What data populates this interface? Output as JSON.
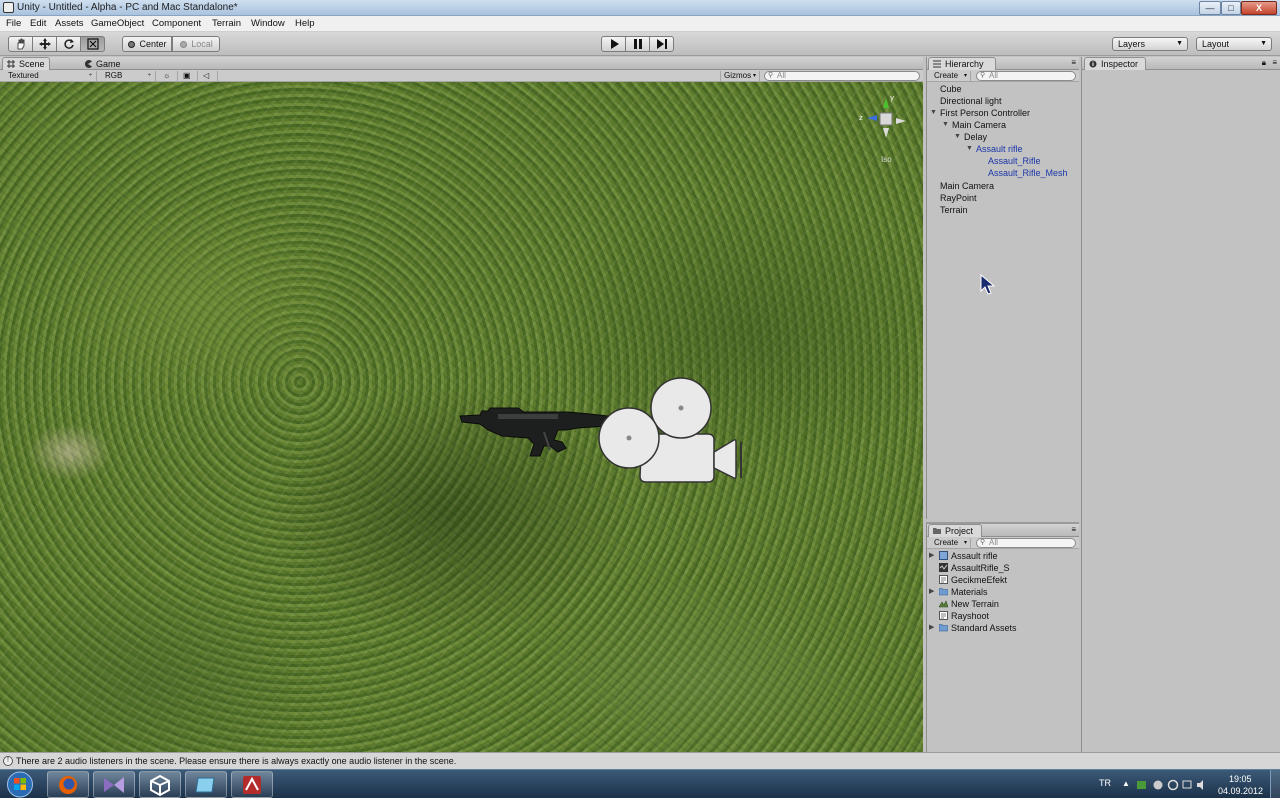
{
  "window": {
    "title": "Unity - Untitled - Alpha - PC and Mac Standalone*",
    "minimize_label": "—",
    "maximize_label": "□",
    "close_label": "X"
  },
  "menu": [
    "File",
    "Edit",
    "Assets",
    "GameObject",
    "Component",
    "Terrain",
    "Window",
    "Help"
  ],
  "toolbar": {
    "pivot_label": "Center",
    "space_label": "Local",
    "layers_label": "Layers",
    "layout_label": "Layout"
  },
  "scene_panel": {
    "tab_scene": "Scene",
    "tab_game": "Game",
    "render_mode": "Textured",
    "color_mode": "RGB",
    "gizmos_label": "Gizmos",
    "search_placeholder": "All",
    "orientation_label": "Iso",
    "axis_y": "y",
    "axis_z": "z"
  },
  "hierarchy": {
    "tab": "Hierarchy",
    "create_label": "Create",
    "search_placeholder": "All",
    "items": [
      {
        "label": "Cube"
      },
      {
        "label": "Directional light"
      },
      {
        "label": "First Person Controller"
      },
      {
        "label": "Main Camera"
      },
      {
        "label": "Delay"
      },
      {
        "label": "Assault rifle"
      },
      {
        "label": "Assault_Rifle"
      },
      {
        "label": "Assault_Rifle_Mesh"
      },
      {
        "label": "Main Camera"
      },
      {
        "label": "RayPoint"
      },
      {
        "label": "Terrain"
      }
    ]
  },
  "project": {
    "tab": "Project",
    "create_label": "Create",
    "search_placeholder": "All",
    "items": [
      {
        "label": "Assault rifle"
      },
      {
        "label": "AssaultRifle_S"
      },
      {
        "label": "GecikmeEfekt"
      },
      {
        "label": "Materials"
      },
      {
        "label": "New Terrain"
      },
      {
        "label": "Rayshoot"
      },
      {
        "label": "Standard Assets"
      }
    ]
  },
  "inspector": {
    "tab": "Inspector"
  },
  "status": {
    "message": "There are 2 audio listeners in the scene. Please ensure there is always exactly one audio listener in the scene."
  },
  "taskbar": {
    "language": "TR",
    "time": "19:05",
    "date": "04.09.2012"
  }
}
